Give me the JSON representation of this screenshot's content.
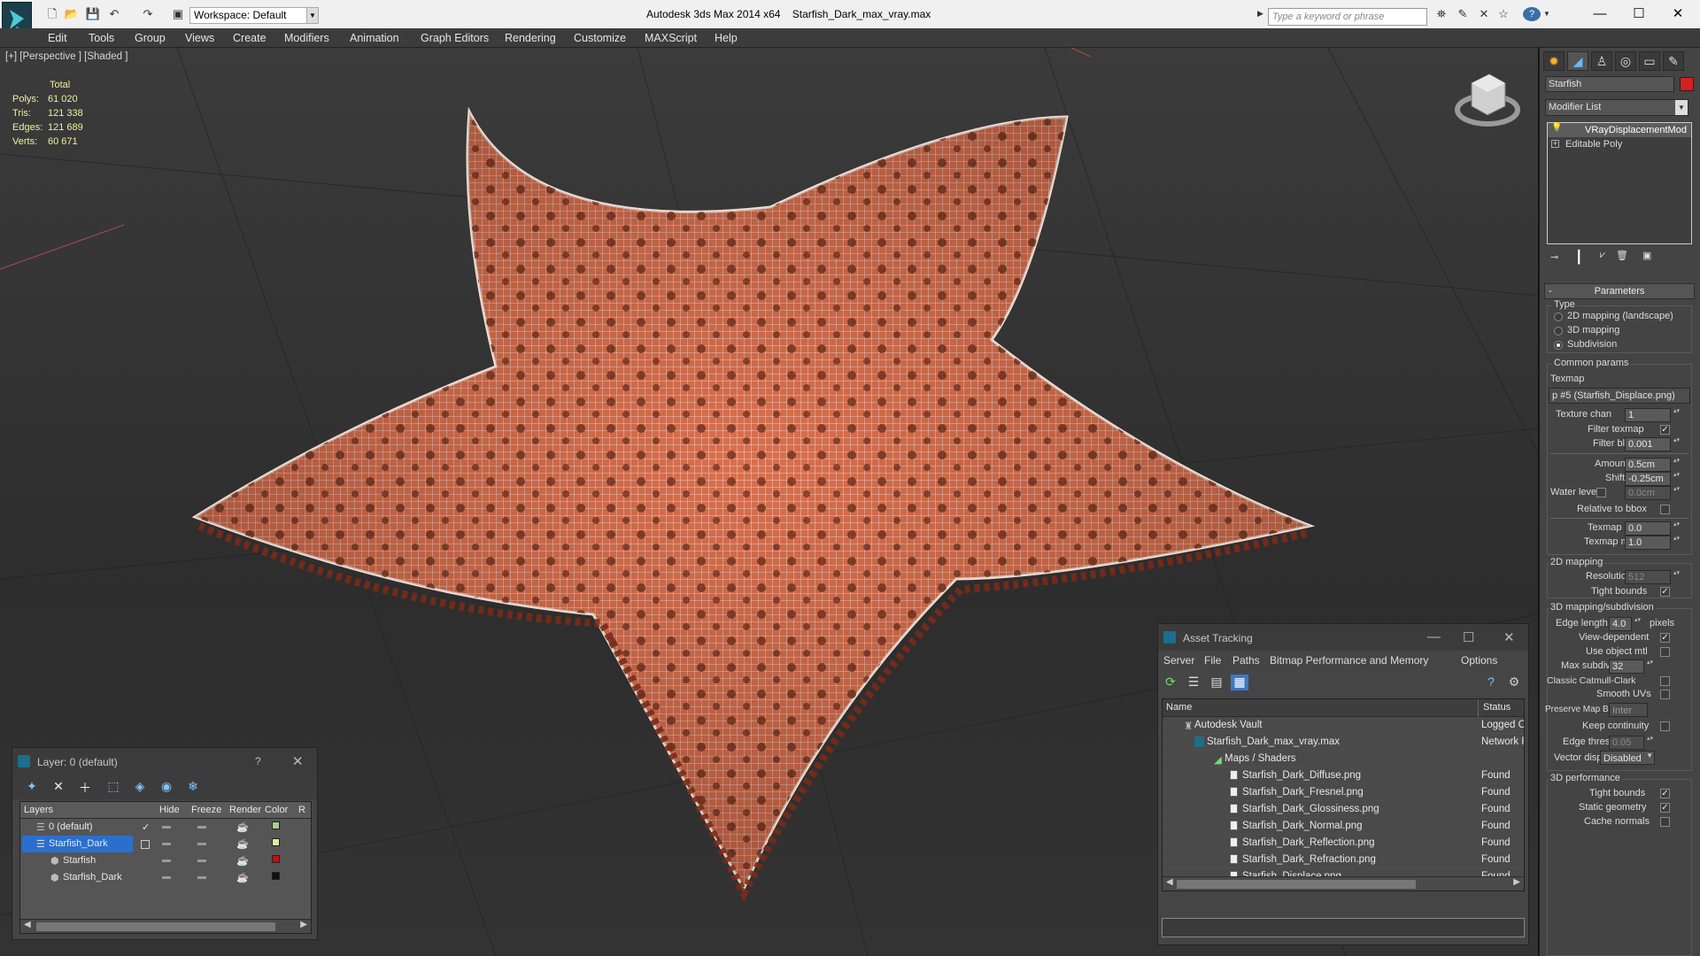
{
  "window": {
    "app_title": "Autodesk 3ds Max  2014 x64",
    "file_title": "Starfish_Dark_max_vray.max",
    "workspace": "Workspace: Default",
    "search_placeholder": "Type a keyword or phrase"
  },
  "menu": [
    "Edit",
    "Tools",
    "Group",
    "Views",
    "Create",
    "Modifiers",
    "Animation",
    "Graph Editors",
    "Rendering",
    "Customize",
    "MAXScript",
    "Help"
  ],
  "viewport": {
    "label": "[+] [Perspective ] [Shaded ]",
    "stats_header": "Total",
    "stats": [
      {
        "k": "Polys:",
        "v": "61 020"
      },
      {
        "k": "Tris:",
        "v": "121 338"
      },
      {
        "k": "Edges:",
        "v": "121 689"
      },
      {
        "k": "Verts:",
        "v": "60 671"
      }
    ],
    "model_color": "#d9704f"
  },
  "layers": {
    "title": "Layer: 0 (default)",
    "help": "?",
    "columns": [
      "Layers",
      "Hide",
      "Freeze",
      "Render",
      "Color",
      "R"
    ],
    "rows": [
      {
        "name": "0 (default)",
        "color": "#a8d08d",
        "check": "✓"
      },
      {
        "name": "Starfish_Dark",
        "color": "#e6e6a0",
        "check": ""
      },
      {
        "name": "Starfish",
        "color": "#c01010",
        "check": ""
      },
      {
        "name": "Starfish_Dark",
        "color": "#111111",
        "check": ""
      }
    ]
  },
  "asset": {
    "title": "Asset Tracking",
    "menus": [
      "Server",
      "File",
      "Paths",
      "Bitmap Performance and Memory",
      "Options"
    ],
    "col_name": "Name",
    "col_status": "Status",
    "rows": [
      {
        "name": "Autodesk Vault",
        "status": "Logged O"
      },
      {
        "name": "Starfish_Dark_max_vray.max",
        "status": "Network F"
      },
      {
        "name": "Maps / Shaders",
        "status": ""
      },
      {
        "name": "Starfish_Dark_Diffuse.png",
        "status": "Found"
      },
      {
        "name": "Starfish_Dark_Fresnel.png",
        "status": "Found"
      },
      {
        "name": "Starfish_Dark_Glossiness.png",
        "status": "Found"
      },
      {
        "name": "Starfish_Dark_Normal.png",
        "status": "Found"
      },
      {
        "name": "Starfish_Dark_Reflection.png",
        "status": "Found"
      },
      {
        "name": "Starfish_Dark_Refraction.png",
        "status": "Found"
      },
      {
        "name": "Starfish_Displace.png",
        "status": "Found"
      }
    ]
  },
  "command": {
    "object_name": "Starfish",
    "object_color": "#d42020",
    "modifier_list": "Modifier List",
    "stack": [
      "VRayDisplacementMod",
      "Editable Poly"
    ],
    "params_title": "Parameters",
    "type_label": "Type",
    "type_options": [
      "2D mapping (landscape)",
      "3D mapping",
      "Subdivision"
    ],
    "common_params": "Common params",
    "texmap_label": "Texmap",
    "texmap_value": "p #5 (Starfish_Displace.png)",
    "texture_chan": {
      "label": "Texture chan",
      "value": "1"
    },
    "filter_texmap": "Filter texmap",
    "filter_blur": {
      "label": "Filter blur",
      "value": "0.001"
    },
    "amount": {
      "label": "Amount",
      "value": "0.5cm"
    },
    "shift": {
      "label": "Shift",
      "value": "-0.25cm"
    },
    "water_level": {
      "label": "Water level",
      "value": "0.0cm"
    },
    "relative_bbox": "Relative to bbox",
    "texmap_min": {
      "label": "Texmap min",
      "value": "0.0"
    },
    "texmap_max": {
      "label": "Texmap max",
      "value": "1.0"
    },
    "mapping_2d": "2D mapping",
    "resolution": {
      "label": "Resolution",
      "value": "512"
    },
    "tight_bounds": "Tight bounds",
    "mapping_3d": "3D mapping/subdivision",
    "edge_length": {
      "label": "Edge length",
      "value": "4.0",
      "unit": "pixels"
    },
    "view_dependent": "View-dependent",
    "use_object_mtl": "Use object mtl",
    "max_subdivs": {
      "label": "Max subdivs",
      "value": "32"
    },
    "classic_catmull": "Classic Catmull-Clark",
    "smooth_uvs": "Smooth UVs",
    "preserve_map": {
      "label": "Preserve Map Bnd",
      "value": "Inter"
    },
    "keep_continuity": "Keep continuity",
    "edge_thresh": {
      "label": "Edge thresh",
      "value": "0.05"
    },
    "vector_displ": {
      "label": "Vector displ",
      "value": "Disabled"
    },
    "perf_3d": "3D performance",
    "tight_bounds2": "Tight bounds",
    "static_geometry": "Static geometry",
    "cache_normals": "Cache normals"
  }
}
